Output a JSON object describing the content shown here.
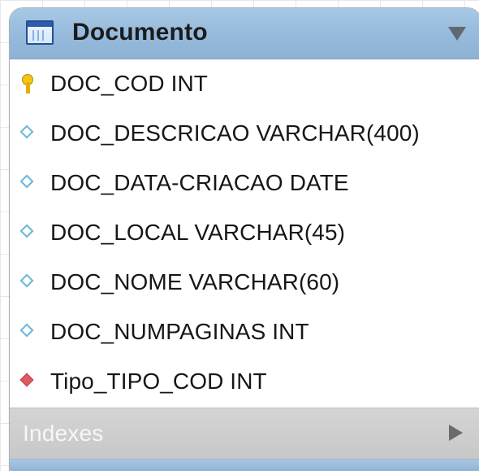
{
  "diagram": {
    "table": {
      "title": "Documento",
      "icon": "table-icon",
      "collapse_icon": "chevron-down-icon",
      "columns": [
        {
          "label": "DOC_COD INT",
          "icon": "primary-key-icon"
        },
        {
          "label": "DOC_DESCRICAO VARCHAR(400)",
          "icon": "column-icon"
        },
        {
          "label": "DOC_DATA-CRIACAO DATE",
          "icon": "column-icon"
        },
        {
          "label": "DOC_LOCAL VARCHAR(45)",
          "icon": "column-icon"
        },
        {
          "label": "DOC_NOME VARCHAR(60)",
          "icon": "column-icon"
        },
        {
          "label": "DOC_NUMPAGINAS INT",
          "icon": "column-icon"
        },
        {
          "label": "Tipo_TIPO_COD INT",
          "icon": "foreign-key-icon"
        }
      ],
      "indexes": {
        "label": "Indexes",
        "expand_icon": "chevron-right-icon"
      }
    },
    "colors": {
      "header": "#95badc",
      "primary_key": "#f3c514",
      "column_marker": "#69b7d8",
      "foreign_key": "#df5a61",
      "indexes_bg": "#cccccc"
    }
  }
}
